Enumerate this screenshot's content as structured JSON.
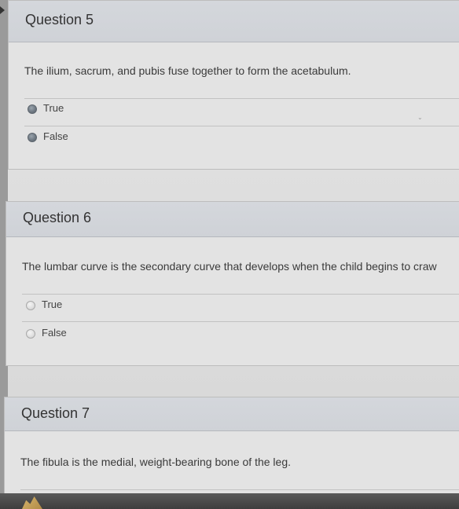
{
  "questions": [
    {
      "title": "Question 5",
      "text": "The ilium, sacrum, and pubis fuse together to form the acetabulum.",
      "options": [
        {
          "label": "True",
          "style": "dark"
        },
        {
          "label": "False",
          "style": "dark"
        }
      ]
    },
    {
      "title": "Question 6",
      "text": "The lumbar curve is the secondary curve that develops when the child begins to craw",
      "options": [
        {
          "label": "True",
          "style": "light"
        },
        {
          "label": "False",
          "style": "light"
        }
      ]
    },
    {
      "title": "Question 7",
      "text": "The fibula is the medial, weight-bearing bone of the leg."
    }
  ],
  "icons": {
    "left_arrow": "chevron-right-icon",
    "bottom": "app-icon"
  }
}
